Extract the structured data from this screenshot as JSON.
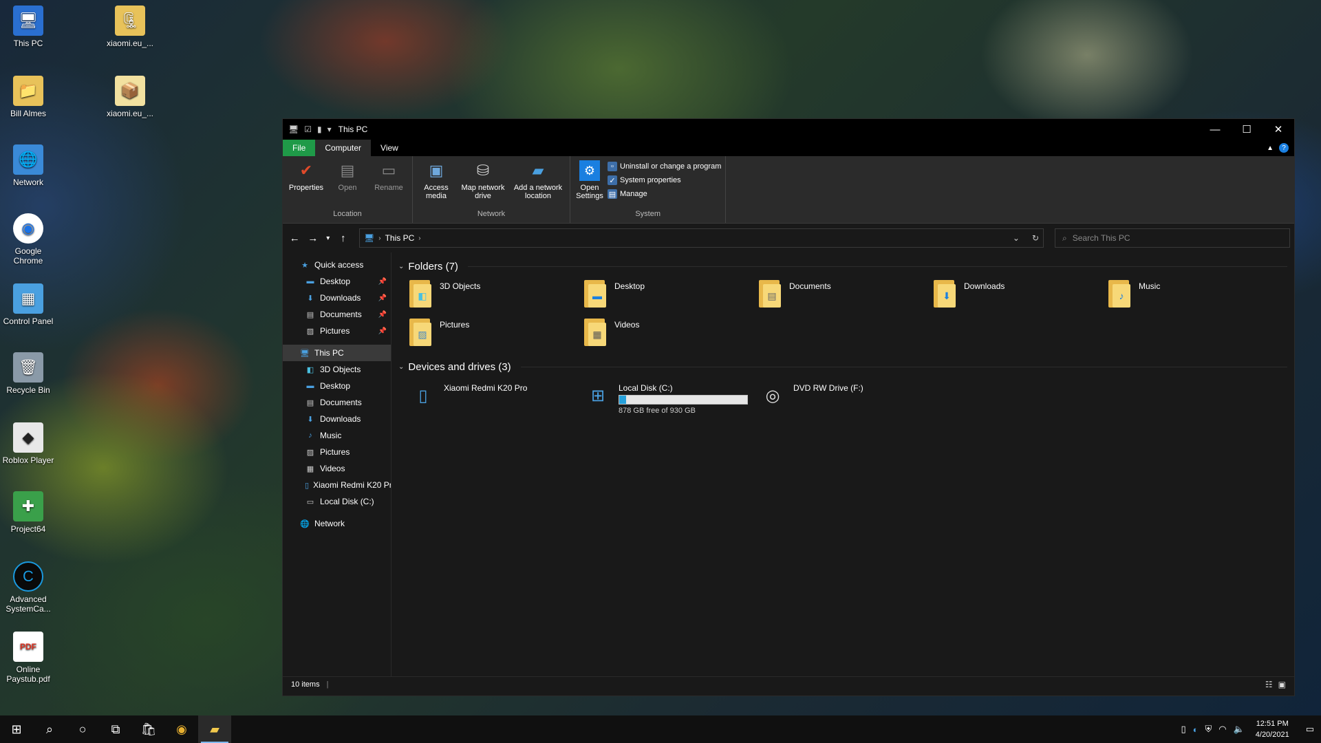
{
  "desktop": {
    "icons": [
      {
        "label": "This PC",
        "glyph": "🖥"
      },
      {
        "label": "xiaomi.eu_...",
        "glyph": "🗜"
      },
      {
        "label": "Bill Almes",
        "glyph": "📁"
      },
      {
        "label": "xiaomi.eu_...",
        "glyph": "📦"
      },
      {
        "label": "Network",
        "glyph": "🌐"
      },
      {
        "label": "Google Chrome",
        "glyph": "◉"
      },
      {
        "label": "Control Panel",
        "glyph": "▦"
      },
      {
        "label": "Recycle Bin",
        "glyph": "🗑"
      },
      {
        "label": "Roblox Player",
        "glyph": "◆"
      },
      {
        "label": "Project64",
        "glyph": "✚"
      },
      {
        "label": "Advanced SystemCa...",
        "glyph": "C"
      },
      {
        "label": "Online Paystub.pdf",
        "glyph": "PDF"
      }
    ]
  },
  "window": {
    "title": "This PC",
    "tabs": {
      "file": "File",
      "computer": "Computer",
      "view": "View"
    },
    "ribbon": {
      "location": {
        "label": "Location",
        "properties": "Properties",
        "open": "Open",
        "rename": "Rename"
      },
      "network": {
        "label": "Network",
        "access_media": "Access media",
        "map_network_drive": "Map network drive",
        "add_network_location": "Add a network location"
      },
      "system": {
        "label": "System",
        "open_settings": "Open Settings",
        "uninstall": "Uninstall or change a program",
        "system_properties": "System properties",
        "manage": "Manage"
      }
    },
    "address": {
      "crumb": "This PC",
      "search_placeholder": "Search This PC"
    },
    "nav": {
      "quick_access": "Quick access",
      "quick_items": [
        "Desktop",
        "Downloads",
        "Documents",
        "Pictures"
      ],
      "this_pc": "This PC",
      "pc_items": [
        "3D Objects",
        "Desktop",
        "Documents",
        "Downloads",
        "Music",
        "Pictures",
        "Videos",
        "Xiaomi Redmi K20 Pro",
        "Local Disk (C:)"
      ],
      "network": "Network"
    },
    "folders_header": "Folders (7)",
    "folders": [
      "3D Objects",
      "Desktop",
      "Documents",
      "Downloads",
      "Music",
      "Pictures",
      "Videos"
    ],
    "devices_header": "Devices and drives (3)",
    "devices": {
      "phone": "Xiaomi Redmi K20 Pro",
      "local_disk": "Local Disk (C:)",
      "local_disk_free": "878 GB free of 930 GB",
      "local_disk_used_fraction": 0.056,
      "dvd": "DVD RW Drive (F:)"
    },
    "status": "10 items"
  },
  "taskbar": {
    "time": "12:51 PM",
    "date": "4/20/2021"
  },
  "colors": {
    "file_tab": "#1f9a48",
    "capacity_fill": "#26a0da",
    "accent": "#1a7fe0"
  }
}
